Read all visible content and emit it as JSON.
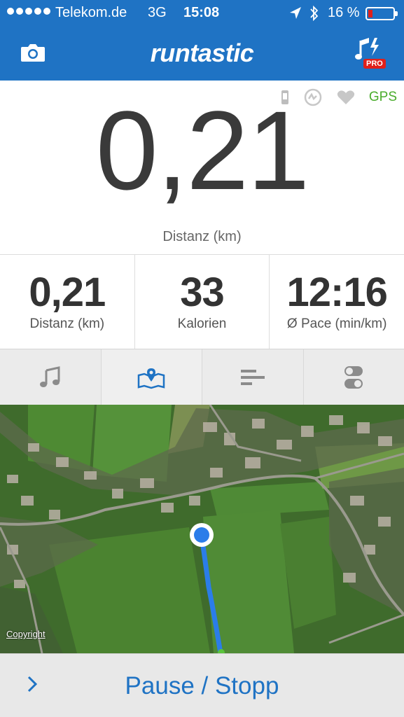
{
  "status_bar": {
    "carrier": "Telekom.de",
    "network": "3G",
    "time": "15:08",
    "battery": "16 %",
    "battery_level": 0.16,
    "icons": [
      "signal-dots-icon",
      "location-arrow-icon",
      "bluetooth-icon",
      "battery-icon"
    ]
  },
  "header": {
    "logo": "runtastic",
    "pro_badge": "PRO",
    "icons": {
      "left": "camera-icon",
      "right": "music-pro-icon"
    }
  },
  "indicators": {
    "gps": "GPS",
    "icons": [
      "phone-icon",
      "heart-rate-sensor-icon",
      "heart-icon"
    ]
  },
  "main_metric": {
    "value": "0,21",
    "label": "Distanz (km)"
  },
  "stats": [
    {
      "value": "0,21",
      "label": "Distanz (km)"
    },
    {
      "value": "33",
      "label": "Kalorien"
    },
    {
      "value": "12:16",
      "label": "Ø Pace (min/km)"
    }
  ],
  "tabs": [
    {
      "icon": "music-note-icon",
      "active": false
    },
    {
      "icon": "map-icon",
      "active": true
    },
    {
      "icon": "bars-icon",
      "active": false
    },
    {
      "icon": "toggles-icon",
      "active": false
    }
  ],
  "map": {
    "copyright": "Copyright"
  },
  "bottom_bar": {
    "label": "Pause / Stopp"
  },
  "colors": {
    "brand_blue": "#1f73c4",
    "gps_green": "#4aac2c",
    "route_blue": "#2b7de9",
    "alert_red": "#e0201a"
  }
}
